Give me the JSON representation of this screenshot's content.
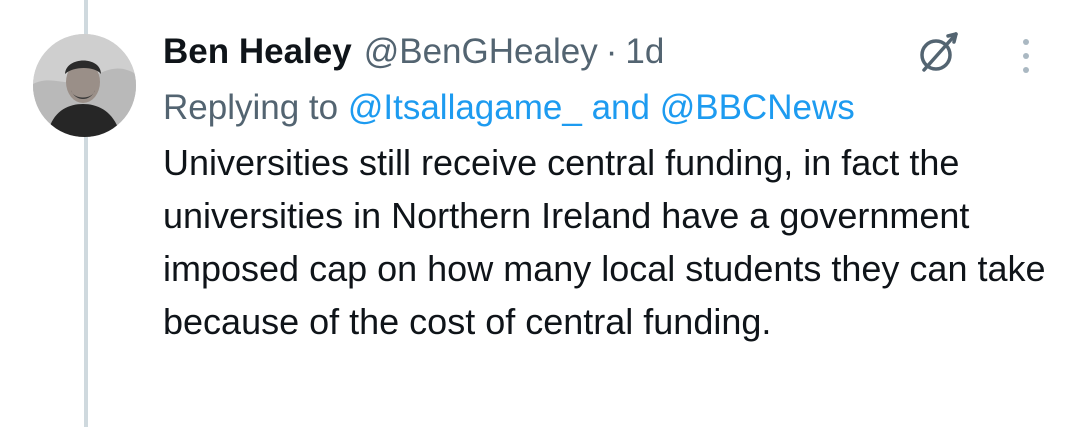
{
  "tweet": {
    "author_name": "Ben Healey",
    "author_handle": "@BenGHealey",
    "separator": "·",
    "timestamp": "1d",
    "reply_prefix": "Replying to",
    "reply_mention_1": "@Itsallagame_",
    "reply_joiner": "and",
    "reply_mention_2": "@BBCNews",
    "text": "Universities still receive central funding, in fact the universities in Northern Ireland have a government imposed cap on how many local students they can take because of the cost of central funding."
  },
  "icons": {
    "avatar": "avatar-photo",
    "grok": "grok-icon",
    "more": "more-vertical-icon"
  },
  "colors": {
    "text_primary": "#0f1419",
    "text_secondary": "#536471",
    "link": "#1d9bf0",
    "thread_line": "#cfd9de"
  }
}
